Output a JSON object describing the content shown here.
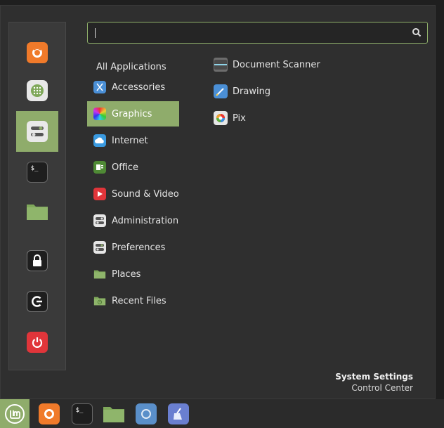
{
  "search": {
    "value": "",
    "placeholder": ""
  },
  "favorites": [
    {
      "name": "firefox"
    },
    {
      "name": "software-manager"
    },
    {
      "name": "system-settings"
    },
    {
      "name": "terminal"
    },
    {
      "name": "files"
    },
    {
      "name": "lock-screen"
    },
    {
      "name": "logout"
    },
    {
      "name": "shutdown"
    }
  ],
  "categories": {
    "all": "All Applications",
    "items": [
      "Accessories",
      "Graphics",
      "Internet",
      "Office",
      "Sound & Video",
      "Administration",
      "Preferences",
      "Places",
      "Recent Files"
    ],
    "selected": "Graphics"
  },
  "apps": [
    "Document Scanner",
    "Drawing",
    "Pix"
  ],
  "status": {
    "title": "System Settings",
    "subtitle": "Control Center"
  },
  "colors": {
    "accent": "#8fac6b",
    "panel": "#2f2f2f",
    "shutdown": "#e0353a",
    "firefox": "#f07a2a"
  }
}
